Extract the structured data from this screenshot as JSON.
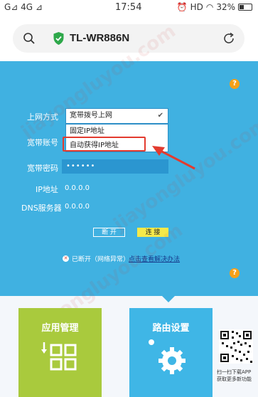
{
  "status_bar": {
    "carrier": "G⊿ 4G ⊿",
    "time": "17:54",
    "hd": "HD",
    "battery": "32%"
  },
  "address_bar": {
    "host": "TL-WR886N"
  },
  "form": {
    "connection_type_label": "上网方式",
    "connection_type_value": "宽带拨号上网",
    "dropdown_options": [
      "固定IP地址",
      "自动获得IP地址"
    ],
    "account_label": "宽带账号",
    "password_label": "宽带密码",
    "password_value": "••••••",
    "ip_label": "IP地址",
    "ip_value": "0.0.0.0",
    "dns_label": "DNS服务器",
    "dns_value": "0.0.0.0"
  },
  "buttons": {
    "disconnect": "断 开",
    "connect": "连 接"
  },
  "connection_status": {
    "text": "已断开（网络异常）",
    "diagnose_link": "点击查看解决办法"
  },
  "tiles": {
    "app_management": "应用管理",
    "router_settings": "路由设置"
  },
  "qr_caption": {
    "line1": "扫一扫下载APP",
    "line2": "获取更多新功能"
  },
  "watermark": "jiayongluyou.com",
  "colors": {
    "panel": "#40b1e1",
    "highlight": "#e33b2f",
    "connect_button": "#f5e94a",
    "app_tile": "#a9ca3d",
    "route_tile": "#3fb6e6"
  }
}
